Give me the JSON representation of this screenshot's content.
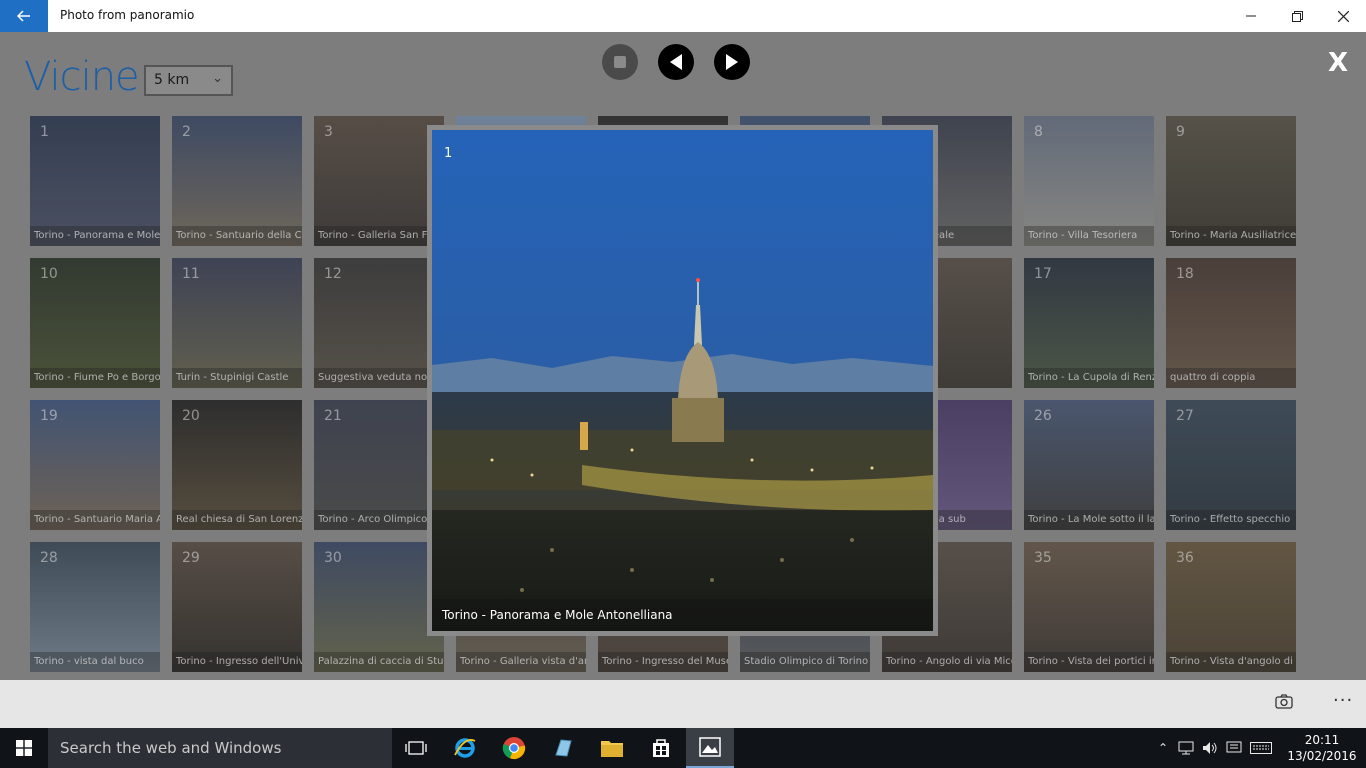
{
  "window": {
    "title": "Photo from panoramio",
    "back_icon": "arrow-left-icon",
    "minimize_icon": "minimize-icon",
    "restore_icon": "restore-icon",
    "close_icon": "close-icon"
  },
  "header": {
    "title": "Vicine",
    "distance_selected": "5 km"
  },
  "controls": {
    "stop_icon": "stop-icon",
    "prev_icon": "prev-icon",
    "next_icon": "next-icon",
    "close_label": "X"
  },
  "tiles": [
    {
      "num": "1",
      "caption": "Torino - Panorama e Mole Antonelliana"
    },
    {
      "num": "2",
      "caption": "Torino - Santuario della Consolata"
    },
    {
      "num": "3",
      "caption": "Torino - Galleria San Federico"
    },
    {
      "num": "",
      "caption": ""
    },
    {
      "num": "",
      "caption": ""
    },
    {
      "num": "",
      "caption": ""
    },
    {
      "num": "",
      "caption": "Palazzo Reale"
    },
    {
      "num": "8",
      "caption": "Torino - Villa Tesoriera"
    },
    {
      "num": "9",
      "caption": "Torino - Maria Ausiliatrice In"
    },
    {
      "num": "10",
      "caption": "Torino - Fiume Po e Borgo Medievale"
    },
    {
      "num": "11",
      "caption": "Turin - Stupinigi Castle"
    },
    {
      "num": "12",
      "caption": "Suggestiva veduta notturna"
    },
    {
      "num": "",
      "caption": ""
    },
    {
      "num": "",
      "caption": ""
    },
    {
      "num": "",
      "caption": ""
    },
    {
      "num": "",
      "caption": ""
    },
    {
      "num": "17",
      "caption": "Torino - La Cupola di Renzo"
    },
    {
      "num": "18",
      "caption": "quattro di coppia"
    },
    {
      "num": "19",
      "caption": "Torino - Santuario Maria Ausiliatrice"
    },
    {
      "num": "20",
      "caption": "Real chiesa di San Lorenzo"
    },
    {
      "num": "21",
      "caption": "Torino - Arco Olimpico"
    },
    {
      "num": "",
      "caption": ""
    },
    {
      "num": "",
      "caption": ""
    },
    {
      "num": "",
      "caption": ""
    },
    {
      "num": "",
      "caption": "ca - galleria sub"
    },
    {
      "num": "26",
      "caption": "Torino - La Mole sotto il lampione"
    },
    {
      "num": "27",
      "caption": "Torino - Effetto specchio"
    },
    {
      "num": "28",
      "caption": "Torino - vista dal buco"
    },
    {
      "num": "29",
      "caption": "Torino - Ingresso dell'Università"
    },
    {
      "num": "30",
      "caption": "Palazzina di caccia di Stupinigi"
    },
    {
      "num": "",
      "caption": "Torino - Galleria vista d'angolo"
    },
    {
      "num": "",
      "caption": "Torino - Ingresso del Museo"
    },
    {
      "num": "",
      "caption": "Stadio Olimpico di Torino"
    },
    {
      "num": "",
      "caption": "Torino - Angolo di via Micca"
    },
    {
      "num": "35",
      "caption": "Torino - Vista dei portici in fila"
    },
    {
      "num": "36",
      "caption": "Torino - Vista d'angolo di Pi"
    }
  ],
  "popup": {
    "num": "1",
    "caption": "Torino - Panorama e Mole Antonelliana"
  },
  "cmdbar": {
    "rotate_icon": "rotate-camera-icon",
    "more_label": "···"
  },
  "taskbar": {
    "search_placeholder": "Search the web and Windows",
    "time": "20:11",
    "date": "13/02/2016"
  }
}
